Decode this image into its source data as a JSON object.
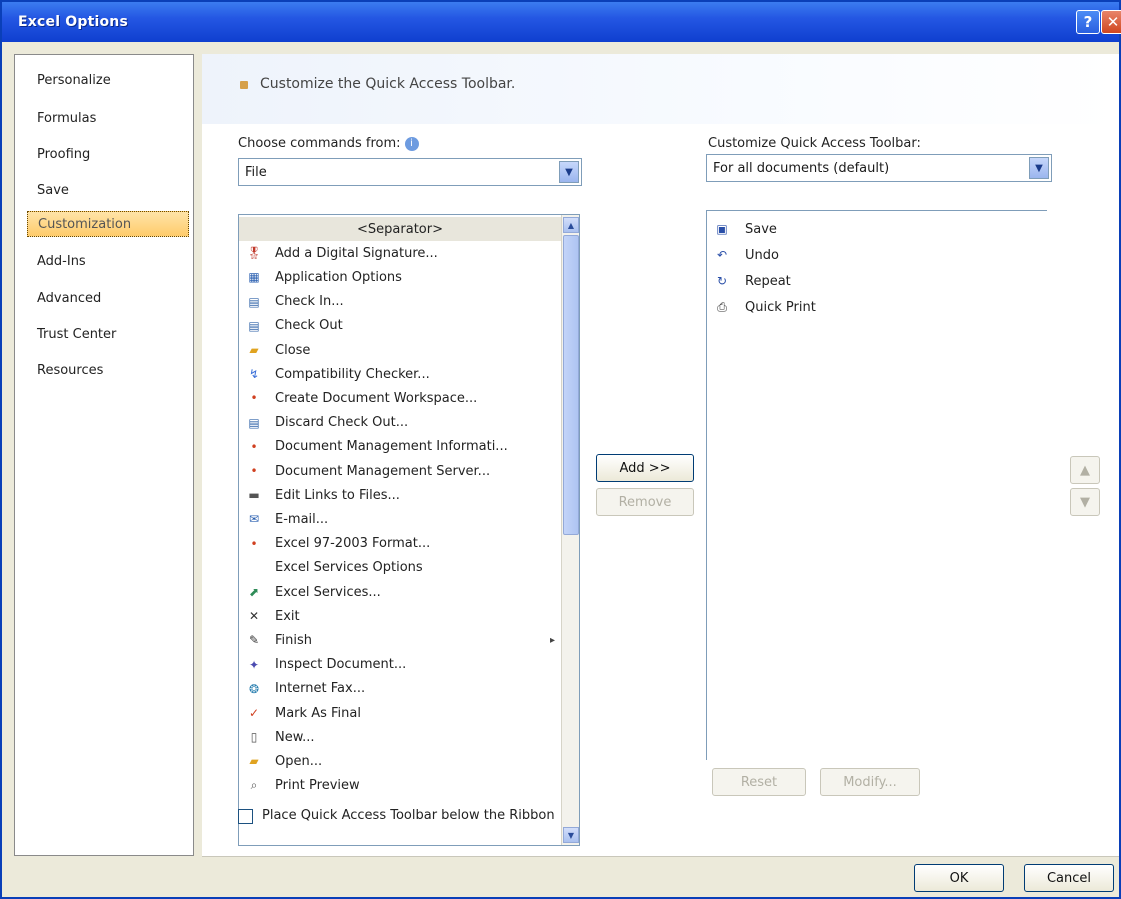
{
  "window": {
    "title": "Excel Options",
    "help_glyph": "?",
    "close_glyph": "✕"
  },
  "nav": {
    "items": [
      {
        "label": "Personalize"
      },
      {
        "label": "Formulas"
      },
      {
        "label": "Proofing"
      },
      {
        "label": "Save"
      },
      {
        "label": "Customization",
        "selected": true
      },
      {
        "label": "Add-Ins"
      },
      {
        "label": "Advanced"
      },
      {
        "label": "Trust Center"
      },
      {
        "label": "Resources"
      }
    ]
  },
  "main": {
    "banner": "Customize the Quick Access Toolbar.",
    "choose_label": "Choose commands from:",
    "choose_value": "File",
    "customize_label": "Customize Quick Access Toolbar:",
    "customize_value": "For all documents (default)",
    "commands": [
      {
        "label": "<Separator>",
        "icon": "separator",
        "separator": true
      },
      {
        "label": "Add a Digital Signature...",
        "icon": "ribbon-award-icon",
        "glyph": "🎖",
        "color": "#c0392b"
      },
      {
        "label": "Application Options",
        "icon": "options-icon",
        "glyph": "▦",
        "color": "#2a5fb0"
      },
      {
        "label": "Check In...",
        "icon": "check-in-icon",
        "glyph": "▤",
        "color": "#3366aa"
      },
      {
        "label": "Check Out",
        "icon": "check-out-icon",
        "glyph": "▤",
        "color": "#3366aa"
      },
      {
        "label": "Close",
        "icon": "folder-close-icon",
        "glyph": "▰",
        "color": "#e0a320"
      },
      {
        "label": "Compatibility Checker...",
        "icon": "compatibility-icon",
        "glyph": "↯",
        "color": "#3a6fd8"
      },
      {
        "label": "Create Document Workspace...",
        "icon": "bullet-icon",
        "glyph": "•",
        "color": "#d04020"
      },
      {
        "label": "Discard Check Out...",
        "icon": "discard-icon",
        "glyph": "▤",
        "color": "#3366aa"
      },
      {
        "label": "Document Management Informati...",
        "icon": "bullet-icon",
        "glyph": "•",
        "color": "#d04020"
      },
      {
        "label": "Document Management Server...",
        "icon": "bullet-icon",
        "glyph": "•",
        "color": "#d04020"
      },
      {
        "label": "Edit Links to Files...",
        "icon": "links-icon",
        "glyph": "▬",
        "color": "#555555"
      },
      {
        "label": "E-mail...",
        "icon": "email-icon",
        "glyph": "✉",
        "color": "#2a5fb0"
      },
      {
        "label": "Excel 97-2003 Format...",
        "icon": "bullet-icon",
        "glyph": "•",
        "color": "#d04020"
      },
      {
        "label": "Excel Services Options",
        "icon": "none",
        "glyph": "",
        "color": "#000000"
      },
      {
        "label": "Excel Services...",
        "icon": "excel-services-icon",
        "glyph": "⬈",
        "color": "#2e8b57"
      },
      {
        "label": "Exit",
        "icon": "exit-icon",
        "glyph": "✕",
        "color": "#333333"
      },
      {
        "label": "Finish",
        "icon": "finish-icon",
        "glyph": "✎",
        "color": "#333333",
        "submenu": true
      },
      {
        "label": "Inspect Document...",
        "icon": "inspect-icon",
        "glyph": "✦",
        "color": "#4a4ab0"
      },
      {
        "label": "Internet Fax...",
        "icon": "fax-icon",
        "glyph": "❂",
        "color": "#2a7fb0"
      },
      {
        "label": "Mark As Final",
        "icon": "mark-final-icon",
        "glyph": "✓",
        "color": "#d04020"
      },
      {
        "label": "New...",
        "icon": "new-document-icon",
        "glyph": "▯",
        "color": "#555555"
      },
      {
        "label": "Open...",
        "icon": "open-folder-icon",
        "glyph": "▰",
        "color": "#e0a320"
      },
      {
        "label": "Print Preview",
        "icon": "print-preview-icon",
        "glyph": "⌕",
        "color": "#555555"
      }
    ],
    "toolbar_items": [
      {
        "label": "Save",
        "icon": "save-icon",
        "glyph": "▣",
        "color": "#2a4fa8"
      },
      {
        "label": "Undo",
        "icon": "undo-icon",
        "glyph": "↶",
        "color": "#2a4fa8"
      },
      {
        "label": "Repeat",
        "icon": "repeat-icon",
        "glyph": "↻",
        "color": "#2a4fa8"
      },
      {
        "label": "Quick Print",
        "icon": "quick-print-icon",
        "glyph": "⎙",
        "color": "#333333"
      }
    ],
    "add_label": "Add >>",
    "remove_label": "Remove",
    "reset_label": "Reset",
    "modify_label": "Modify...",
    "move_up_glyph": "▲",
    "move_down_glyph": "▼",
    "place_below_label": "Place Quick Access Toolbar below the Ribbon",
    "place_below_checked": false
  },
  "footer": {
    "ok_label": "OK",
    "cancel_label": "Cancel"
  }
}
